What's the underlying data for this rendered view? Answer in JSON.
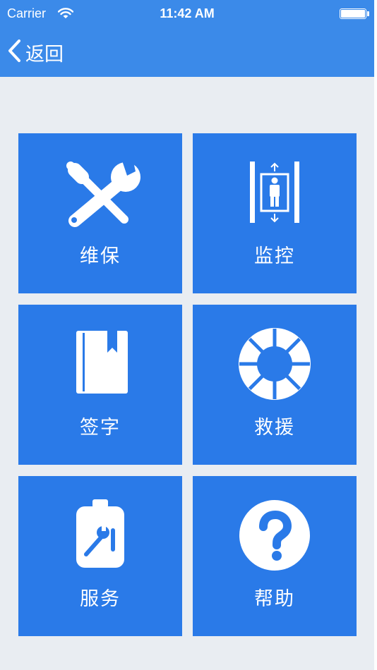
{
  "status_bar": {
    "carrier": "Carrier",
    "time": "11:42 AM"
  },
  "nav": {
    "back_label": "返回"
  },
  "colors": {
    "bar": "#3b8ae9",
    "tile": "#2a7ae8",
    "background": "#e9edf2"
  },
  "tiles": [
    {
      "label": "维保",
      "icon": "wrench-screwdriver-icon"
    },
    {
      "label": "监控",
      "icon": "elevator-icon"
    },
    {
      "label": "签字",
      "icon": "book-bookmark-icon"
    },
    {
      "label": "救援",
      "icon": "lifebuoy-icon"
    },
    {
      "label": "服务",
      "icon": "service-tool-icon"
    },
    {
      "label": "帮助",
      "icon": "question-circle-icon"
    }
  ]
}
